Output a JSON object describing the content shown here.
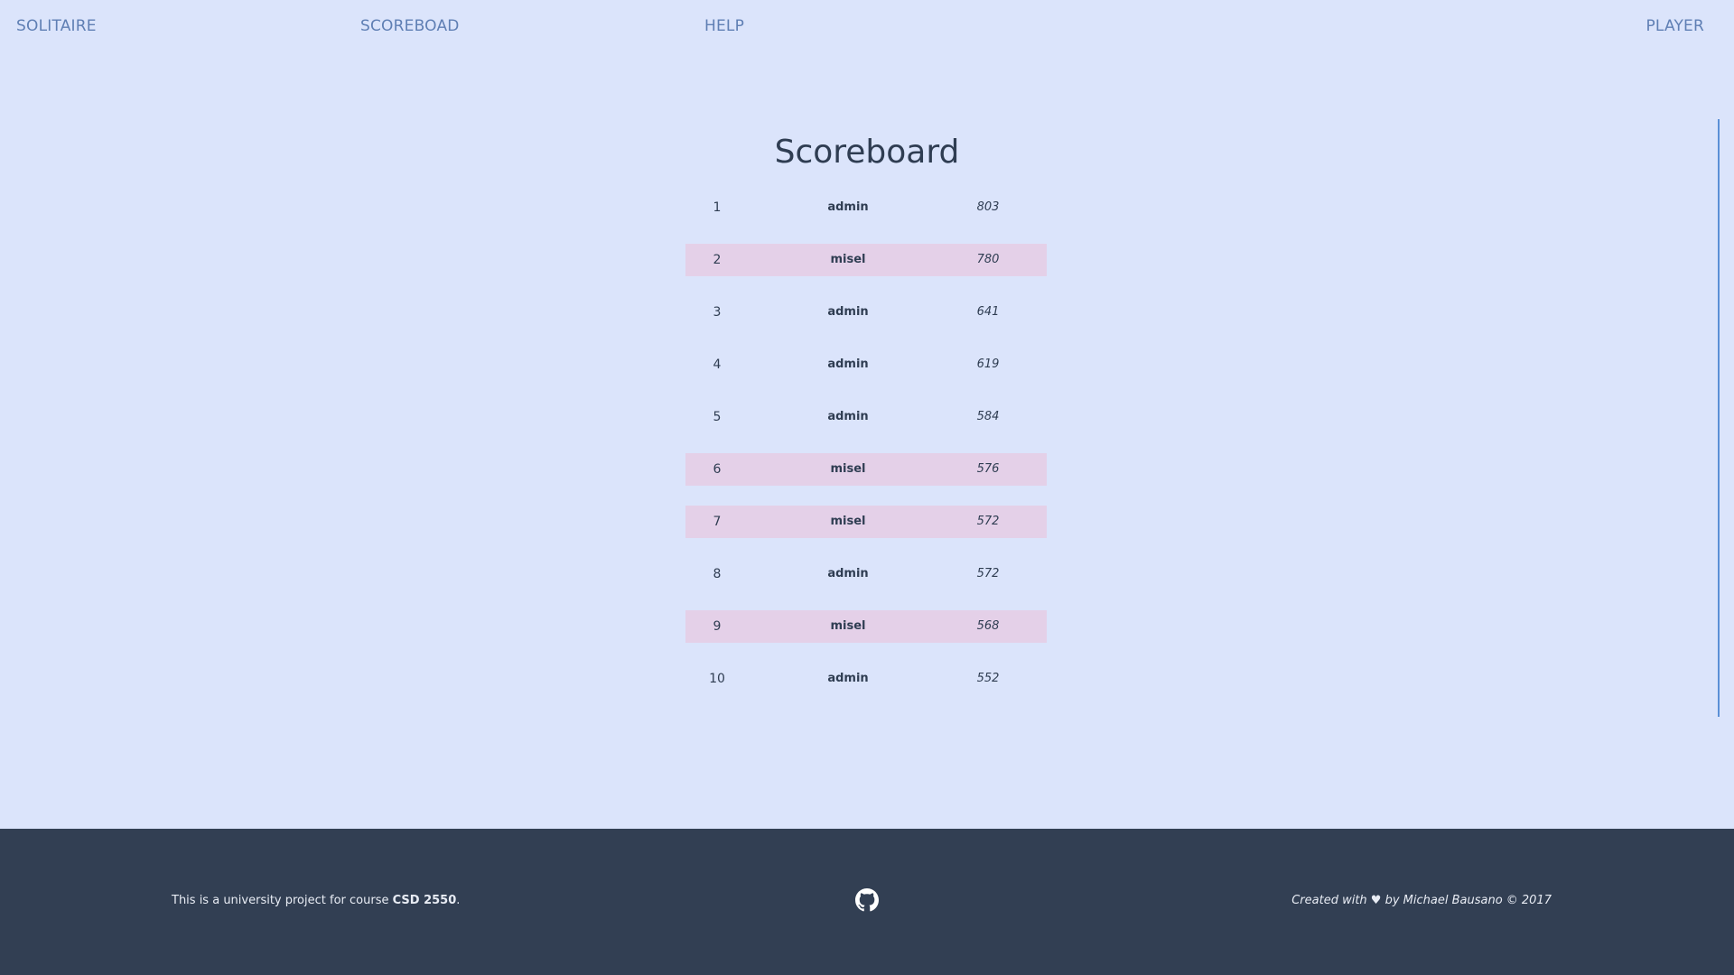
{
  "nav": {
    "solitaire": "SOLITAIRE",
    "scoreboard": "SCOREBOAD",
    "help": "HELP",
    "player": "PLAYER"
  },
  "main": {
    "title": "Scoreboard",
    "rows": [
      {
        "rank": "1",
        "name": "admin",
        "score": "803",
        "highlight": false
      },
      {
        "rank": "2",
        "name": "misel",
        "score": "780",
        "highlight": true
      },
      {
        "rank": "3",
        "name": "admin",
        "score": "641",
        "highlight": false
      },
      {
        "rank": "4",
        "name": "admin",
        "score": "619",
        "highlight": false
      },
      {
        "rank": "5",
        "name": "admin",
        "score": "584",
        "highlight": false
      },
      {
        "rank": "6",
        "name": "misel",
        "score": "576",
        "highlight": true
      },
      {
        "rank": "7",
        "name": "misel",
        "score": "572",
        "highlight": true
      },
      {
        "rank": "8",
        "name": "admin",
        "score": "572",
        "highlight": false
      },
      {
        "rank": "9",
        "name": "misel",
        "score": "568",
        "highlight": true
      },
      {
        "rank": "10",
        "name": "admin",
        "score": "552",
        "highlight": false
      }
    ]
  },
  "footer": {
    "left_text": "This is a university project for course ",
    "left_course": "CSD 2550",
    "left_end": ".",
    "github_icon": "github-icon",
    "right_text": "Created with ♥ by Michael Bausano © 2017"
  },
  "colors": {
    "background": "#dbe4fb",
    "nav_link": "#5f7fb4",
    "row_highlight": "#e4d0e8",
    "footer_bg": "#323f53"
  }
}
